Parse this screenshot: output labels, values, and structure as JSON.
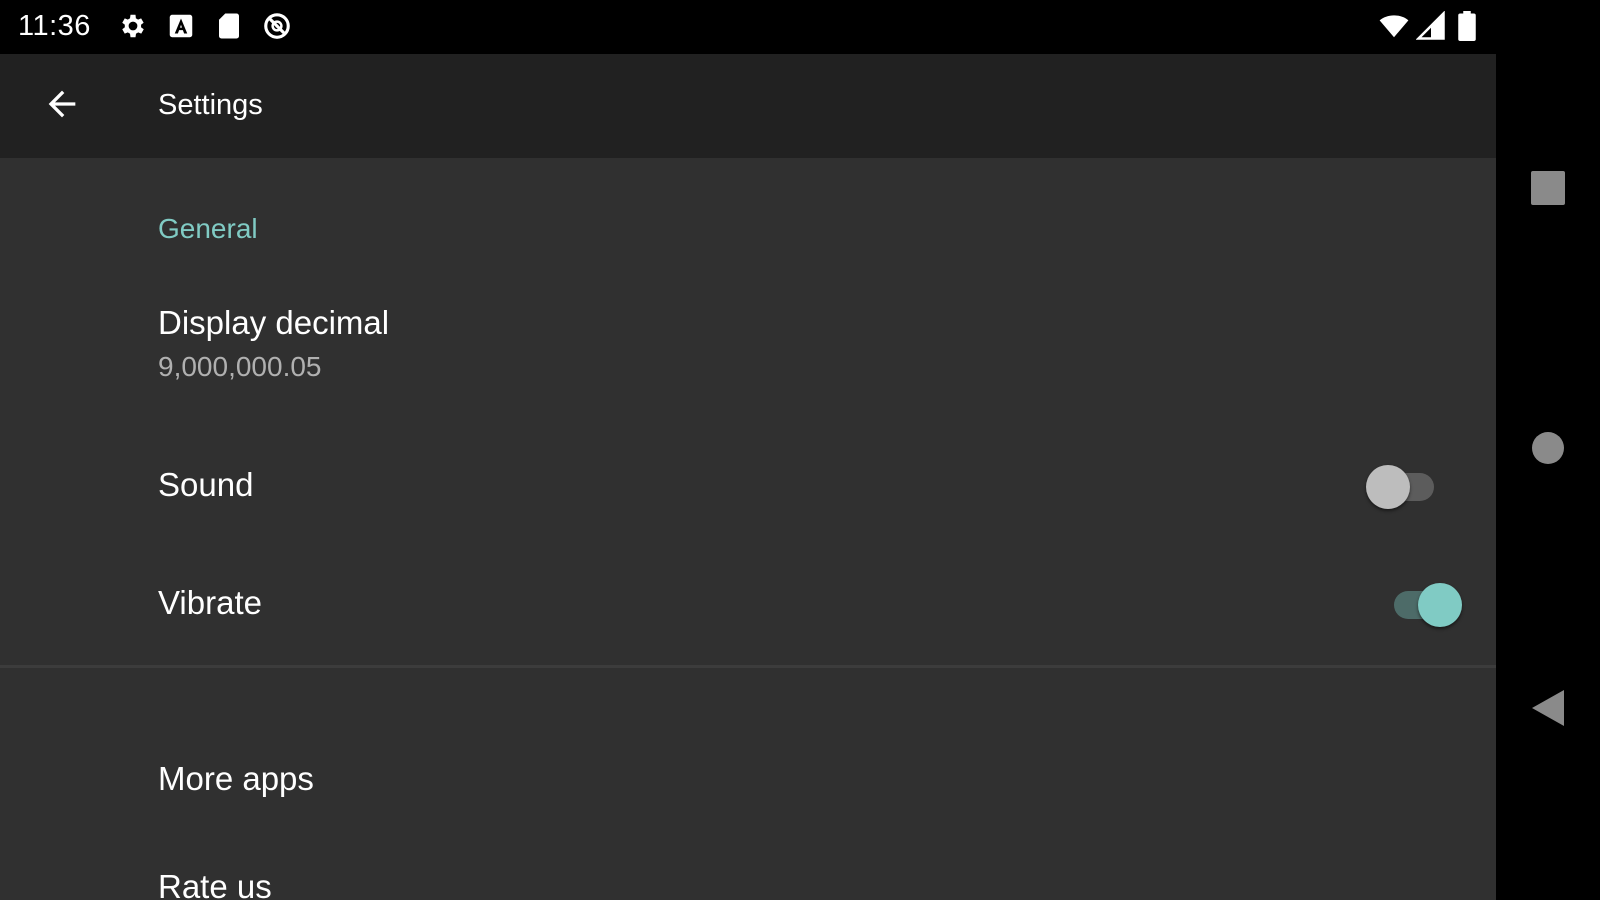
{
  "status_bar": {
    "time": "11:36",
    "icons_left": [
      "gear-icon",
      "a-box-icon",
      "sd-card-icon",
      "blocked-circle-icon"
    ],
    "icons_right": [
      "wifi-icon",
      "signal-icon",
      "battery-icon"
    ]
  },
  "toolbar": {
    "title": "Settings",
    "back_icon": "arrow-back-icon"
  },
  "general": {
    "header": "General",
    "display_decimal": {
      "title": "Display decimal",
      "summary": "9,000,000.05"
    },
    "sound": {
      "title": "Sound",
      "enabled": false
    },
    "vibrate": {
      "title": "Vibrate",
      "enabled": true
    }
  },
  "other": {
    "more_apps": "More apps",
    "rate_us": "Rate us"
  },
  "nav_bar": {
    "buttons": [
      "recents-icon",
      "home-icon",
      "back-triangle-icon"
    ]
  },
  "colors": {
    "accent": "#80cbc4",
    "background": "#303030",
    "toolbar": "#212121"
  }
}
